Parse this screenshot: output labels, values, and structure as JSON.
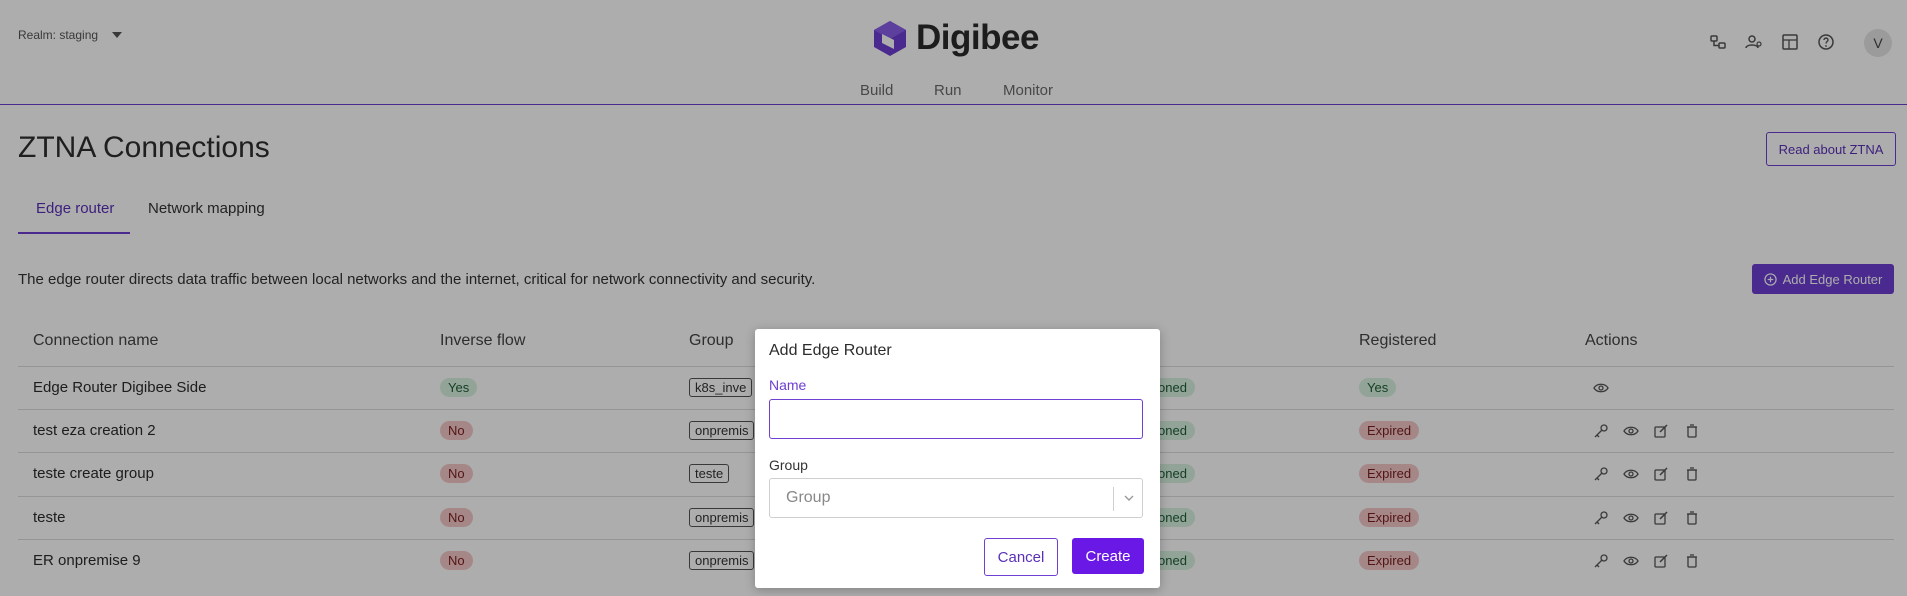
{
  "header": {
    "realm_label": "Realm: staging",
    "brand": "Digibee",
    "avatar_initial": "V",
    "nav": [
      "Build",
      "Run",
      "Monitor"
    ]
  },
  "page": {
    "title": "ZTNA Connections",
    "read_button": "Read about ZTNA",
    "tabs": [
      "Edge router",
      "Network mapping"
    ],
    "description": "The edge router directs data traffic between local networks and the internet, critical for network connectivity and security.",
    "add_button": "Add Edge Router"
  },
  "table": {
    "headers": [
      "Connection name",
      "Inverse flow",
      "Group",
      "Registered",
      "Actions"
    ],
    "rows": [
      {
        "name": "Edge Router Digibee Side",
        "inverse": "Yes",
        "group": "k8s_inve",
        "status": "oned",
        "registered": "Yes"
      },
      {
        "name": "test eza creation 2",
        "inverse": "No",
        "group": "onpremis",
        "status": "oned",
        "registered": "Expired"
      },
      {
        "name": "teste create group",
        "inverse": "No",
        "group": "teste",
        "status": "oned",
        "registered": "Expired"
      },
      {
        "name": "teste",
        "inverse": "No",
        "group": "onpremis",
        "status": "oned",
        "registered": "Expired"
      },
      {
        "name": "ER onpremise 9",
        "inverse": "No",
        "group": "onpremis",
        "status": "oned",
        "registered": "Expired"
      }
    ]
  },
  "modal": {
    "title": "Add Edge Router",
    "name_label": "Name",
    "name_value": "",
    "group_label": "Group",
    "group_placeholder": "Group",
    "cancel": "Cancel",
    "create": "Create"
  },
  "colors": {
    "accent": "#6e3fd1",
    "primary_button": "#6a18e6",
    "pill_green": "#d7f2e1",
    "pill_red": "#f5c8c8"
  }
}
